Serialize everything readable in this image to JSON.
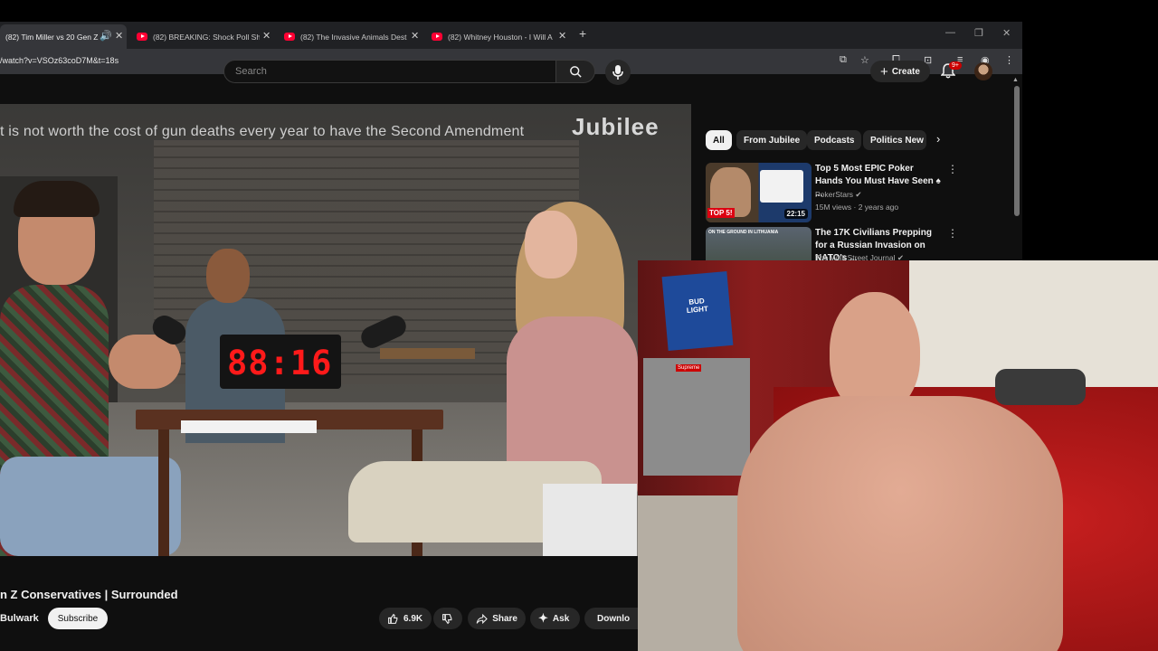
{
  "browser": {
    "tabs": [
      {
        "title": "(82) Tim Miller vs 20 Gen Z",
        "active": true
      },
      {
        "title": "(82) BREAKING: Shock Poll Sho"
      },
      {
        "title": "(82) The Invasive Animals Dest"
      },
      {
        "title": "(82) Whitney Houston - I Will A"
      }
    ],
    "new_tab": "+",
    "url": "/watch?v=VSOz63coD7M&t=18s"
  },
  "header": {
    "search_placeholder": "Search",
    "create_label": "Create",
    "notification_count": "9+"
  },
  "video": {
    "caption": "t is not worth the cost of gun deaths every year to have the Second Amendment",
    "logo": "Jubilee",
    "timer": "88:16",
    "title": "n Z Conservatives | Surrounded",
    "channel": "Bulwark",
    "subscribe_label": "Subscribe",
    "likes": "6.9K",
    "share_label": "Share",
    "ask_label": "Ask",
    "download_label": "Downlo"
  },
  "sidebar": {
    "chips": [
      "All",
      "From Jubilee",
      "Podcasts",
      "Politics New"
    ],
    "videos": [
      {
        "title": "Top 5 Most EPIC Poker Hands You Must Have Seen ♠ ...",
        "channel": "PokerStars",
        "meta": "15M views · 2 years ago",
        "duration": "22:15",
        "thumb_text": "TOP 5!"
      },
      {
        "title": "The 17K Civilians Prepping for a Russian Invasion on NATO's ...",
        "channel": "The Wall Street Journal",
        "thumb_text": "ON THE GROUND IN LITHUANIA"
      }
    ]
  },
  "webcam": {
    "sign_text": "BUD LIGHT",
    "sticker_text": "Supreme"
  },
  "colors": {
    "yt_red": "#ff0033",
    "timer_red": "#ff1a1a",
    "bg": "#0f0f0f"
  }
}
